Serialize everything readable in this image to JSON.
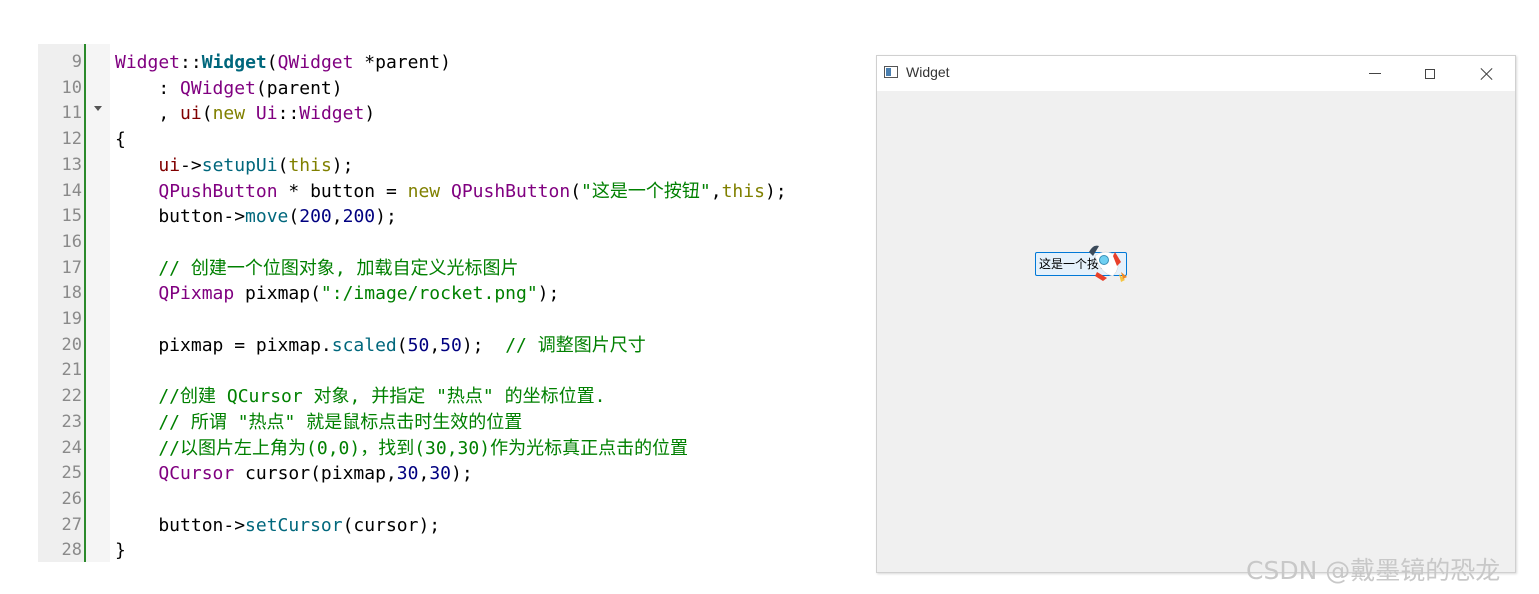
{
  "editor": {
    "lines": [
      {
        "n": "9",
        "tokens": [
          {
            "t": "Widget",
            "c": "t-type"
          },
          {
            "t": "::",
            "c": ""
          },
          {
            "t": "Widget",
            "c": "t-fnb"
          },
          {
            "t": "(",
            "c": ""
          },
          {
            "t": "QWidget",
            "c": "t-type"
          },
          {
            "t": " *parent)",
            "c": ""
          }
        ]
      },
      {
        "n": "10",
        "tokens": [
          {
            "t": "    : ",
            "c": ""
          },
          {
            "t": "QWidget",
            "c": "t-type"
          },
          {
            "t": "(parent)",
            "c": ""
          }
        ]
      },
      {
        "n": "11",
        "tokens": [
          {
            "t": "    , ",
            "c": ""
          },
          {
            "t": "ui",
            "c": "t-mem"
          },
          {
            "t": "(",
            "c": ""
          },
          {
            "t": "new",
            "c": "t-kw"
          },
          {
            "t": " ",
            "c": ""
          },
          {
            "t": "Ui",
            "c": "t-type"
          },
          {
            "t": "::",
            "c": ""
          },
          {
            "t": "Widget",
            "c": "t-type"
          },
          {
            "t": ")",
            "c": ""
          }
        ]
      },
      {
        "n": "12",
        "tokens": [
          {
            "t": "{",
            "c": ""
          }
        ]
      },
      {
        "n": "13",
        "tokens": [
          {
            "t": "    ",
            "c": ""
          },
          {
            "t": "ui",
            "c": "t-mem"
          },
          {
            "t": "->",
            "c": ""
          },
          {
            "t": "setupUi",
            "c": "t-fn"
          },
          {
            "t": "(",
            "c": ""
          },
          {
            "t": "this",
            "c": "t-kw"
          },
          {
            "t": ");",
            "c": ""
          }
        ]
      },
      {
        "n": "14",
        "tokens": [
          {
            "t": "    ",
            "c": ""
          },
          {
            "t": "QPushButton",
            "c": "t-type"
          },
          {
            "t": " * button = ",
            "c": ""
          },
          {
            "t": "new",
            "c": "t-kw"
          },
          {
            "t": " ",
            "c": ""
          },
          {
            "t": "QPushButton",
            "c": "t-type"
          },
          {
            "t": "(",
            "c": ""
          },
          {
            "t": "\"这是一个按钮\"",
            "c": "t-str"
          },
          {
            "t": ",",
            "c": ""
          },
          {
            "t": "this",
            "c": "t-kw"
          },
          {
            "t": ");",
            "c": ""
          }
        ]
      },
      {
        "n": "15",
        "tokens": [
          {
            "t": "    button->",
            "c": ""
          },
          {
            "t": "move",
            "c": "t-fn"
          },
          {
            "t": "(",
            "c": ""
          },
          {
            "t": "200",
            "c": "t-num"
          },
          {
            "t": ",",
            "c": ""
          },
          {
            "t": "200",
            "c": "t-num"
          },
          {
            "t": ");",
            "c": ""
          }
        ]
      },
      {
        "n": "16",
        "tokens": []
      },
      {
        "n": "17",
        "tokens": [
          {
            "t": "    // 创建一个位图对象, 加载自定义光标图片",
            "c": "t-cmt"
          }
        ]
      },
      {
        "n": "18",
        "tokens": [
          {
            "t": "    ",
            "c": ""
          },
          {
            "t": "QPixmap",
            "c": "t-type"
          },
          {
            "t": " pixmap(",
            "c": ""
          },
          {
            "t": "\":/image/rocket.png\"",
            "c": "t-str"
          },
          {
            "t": ");",
            "c": ""
          }
        ]
      },
      {
        "n": "19",
        "tokens": []
      },
      {
        "n": "20",
        "tokens": [
          {
            "t": "    pixmap = pixmap.",
            "c": ""
          },
          {
            "t": "scaled",
            "c": "t-fn"
          },
          {
            "t": "(",
            "c": ""
          },
          {
            "t": "50",
            "c": "t-num"
          },
          {
            "t": ",",
            "c": ""
          },
          {
            "t": "50",
            "c": "t-num"
          },
          {
            "t": ");  ",
            "c": ""
          },
          {
            "t": "// 调整图片尺寸",
            "c": "t-cmt"
          }
        ]
      },
      {
        "n": "21",
        "tokens": []
      },
      {
        "n": "22",
        "tokens": [
          {
            "t": "    //创建 QCursor 对象, 并指定 \"热点\" 的坐标位置.",
            "c": "t-cmt"
          }
        ]
      },
      {
        "n": "23",
        "tokens": [
          {
            "t": "    // 所谓 \"热点\" 就是鼠标点击时生效的位置",
            "c": "t-cmt"
          }
        ]
      },
      {
        "n": "24",
        "tokens": [
          {
            "t": "    //以图片左上角为(0,0)，找到(30,30)作为光标真正点击的位置",
            "c": "t-cmt"
          }
        ]
      },
      {
        "n": "25",
        "tokens": [
          {
            "t": "    ",
            "c": ""
          },
          {
            "t": "QCursor",
            "c": "t-type"
          },
          {
            "t": " cursor(pixmap,",
            "c": ""
          },
          {
            "t": "30",
            "c": "t-num"
          },
          {
            "t": ",",
            "c": ""
          },
          {
            "t": "30",
            "c": "t-num"
          },
          {
            "t": ");",
            "c": ""
          }
        ]
      },
      {
        "n": "26",
        "tokens": []
      },
      {
        "n": "27",
        "tokens": [
          {
            "t": "    button->",
            "c": ""
          },
          {
            "t": "setCursor",
            "c": "t-fn"
          },
          {
            "t": "(cursor);",
            "c": ""
          }
        ]
      },
      {
        "n": "28",
        "tokens": [
          {
            "t": "}",
            "c": ""
          }
        ]
      }
    ]
  },
  "window": {
    "title": "Widget",
    "button_label": "这是一个按钮",
    "cursor_icon": "rocket-icon"
  },
  "watermark": "CSDN @戴墨镜的恐龙",
  "colors": {
    "gutter_bar": "#2b8a2b",
    "button_border": "#0078d7",
    "button_bg": "#e5f1fb"
  }
}
